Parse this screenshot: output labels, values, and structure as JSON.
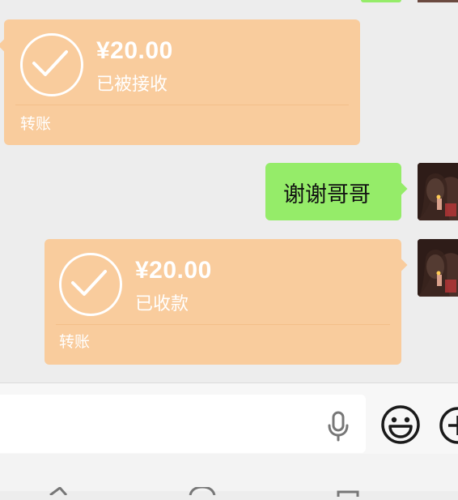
{
  "messages": [
    {
      "type": "transfer",
      "side": "received",
      "amount": "¥20.00",
      "status": "已被接收",
      "footer": "转账"
    },
    {
      "type": "text",
      "side": "sent",
      "text": "谢谢哥哥"
    },
    {
      "type": "transfer",
      "side": "sent",
      "amount": "¥20.00",
      "status": "已收款",
      "footer": "转账"
    }
  ],
  "input_bar": {
    "placeholder": "",
    "icons": [
      "microphone-icon",
      "emoji-icon",
      "plus-icon"
    ]
  },
  "nav_bar": {
    "icons": [
      "back-icon",
      "home-icon",
      "recents-icon"
    ]
  },
  "colors": {
    "background": "#ededed",
    "transfer_bubble": "#f9cc9d",
    "sent_bubble": "#95ec69",
    "text_on_transfer": "#ffffff"
  }
}
